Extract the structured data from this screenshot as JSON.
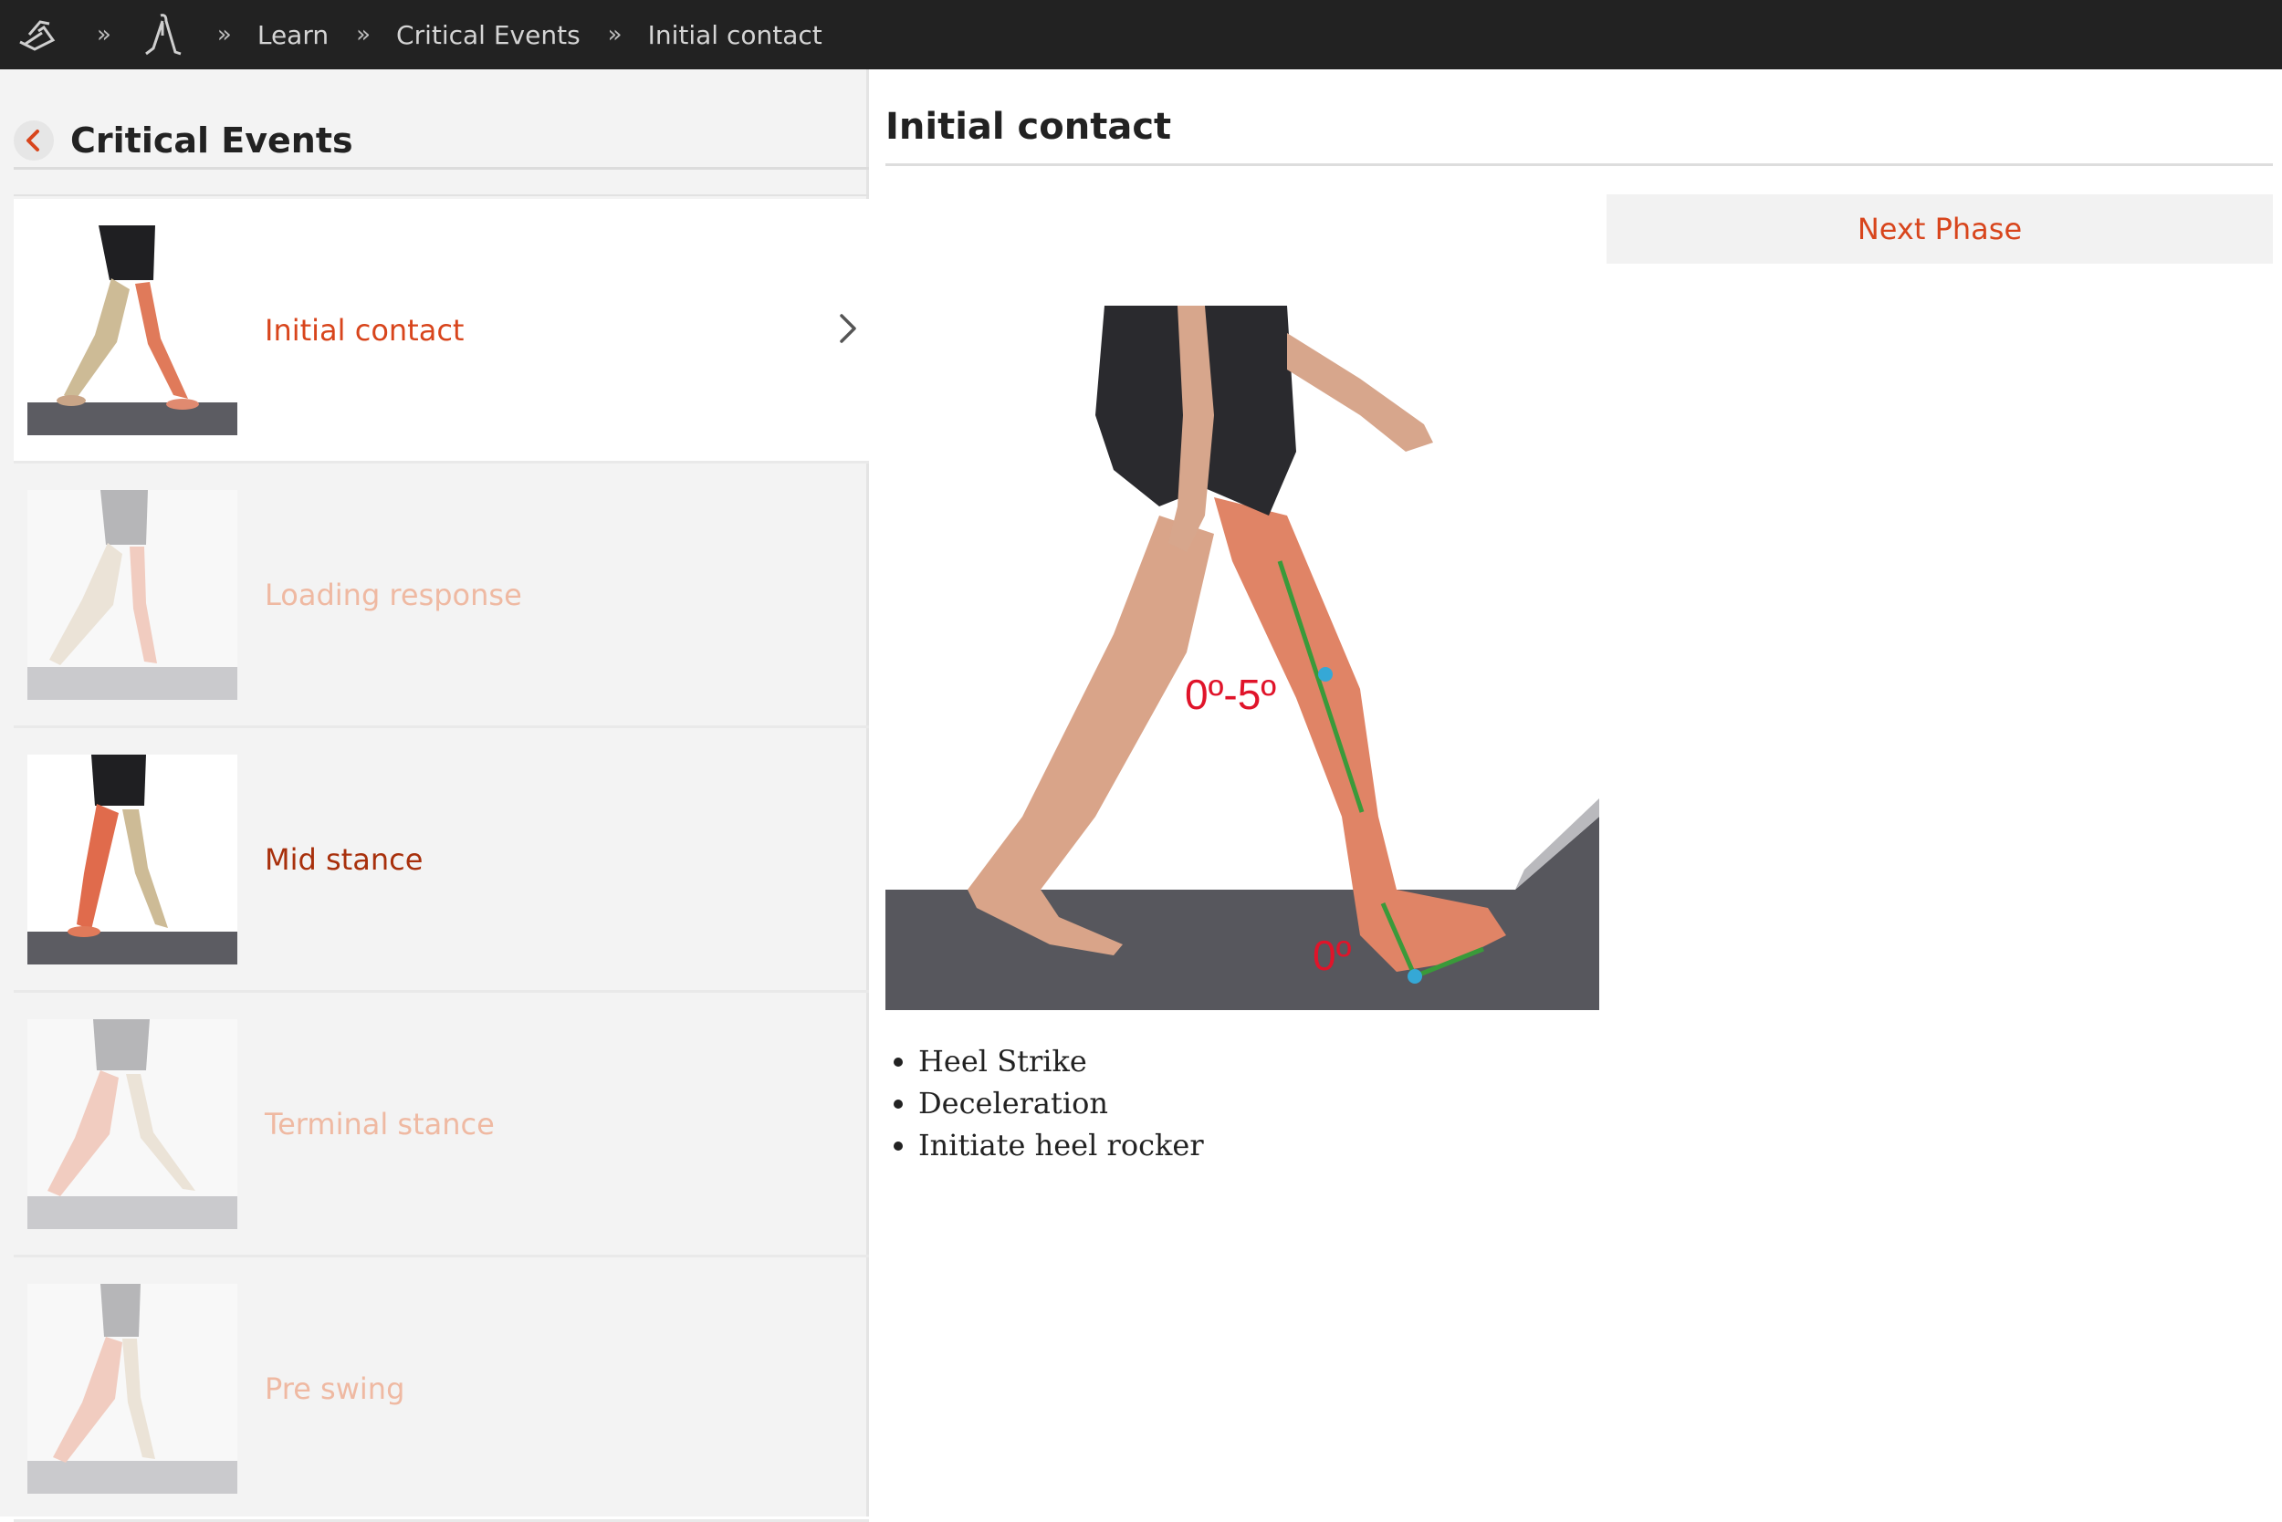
{
  "breadcrumb": {
    "separator": "»",
    "items": [
      "Learn",
      "Critical Events",
      "Initial contact"
    ]
  },
  "sidebar": {
    "title": "Critical Events",
    "items": [
      {
        "label": "Initial contact",
        "color": "#d8451c",
        "active": true
      },
      {
        "label": "Loading response",
        "color": "#efb9a2",
        "active": false
      },
      {
        "label": "Mid stance",
        "color": "#a8300c",
        "active": false
      },
      {
        "label": "Terminal stance",
        "color": "#efb9a2",
        "active": false
      },
      {
        "label": "Pre swing",
        "color": "#efb9a2",
        "active": false
      }
    ]
  },
  "main": {
    "title": "Initial contact",
    "next_button": "Next Phase",
    "figure": {
      "knee_angle": "0º-5º",
      "ankle_angle": "0º"
    },
    "points": [
      "Heel Strike",
      "Deceleration",
      "Initiate heel rocker"
    ]
  },
  "colors": {
    "accent": "#d8451c",
    "topbar": "#222222",
    "angle_label": "#e0142a",
    "angle_line": "#3a9a3a",
    "joint_marker": "#35a8d6"
  },
  "icons": [
    "app-logo-icon",
    "walking-icon",
    "back-arrow-icon",
    "chevron-right-icon"
  ]
}
